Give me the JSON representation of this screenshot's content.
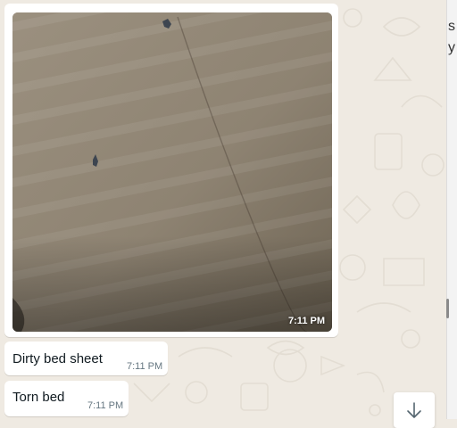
{
  "right_pane": {
    "clipped_text": "s\ny"
  },
  "messages": [
    {
      "type": "image",
      "time": "7:11 PM"
    },
    {
      "type": "text",
      "text": "Dirty bed sheet",
      "time": "7:11 PM"
    },
    {
      "type": "text",
      "text": "Torn bed",
      "time": "7:11 PM"
    }
  ],
  "scroll_button": {
    "icon": "arrow-down-icon"
  },
  "colors": {
    "chat_background": "#efeae2",
    "bubble": "#ffffff",
    "time_text": "#667781"
  }
}
